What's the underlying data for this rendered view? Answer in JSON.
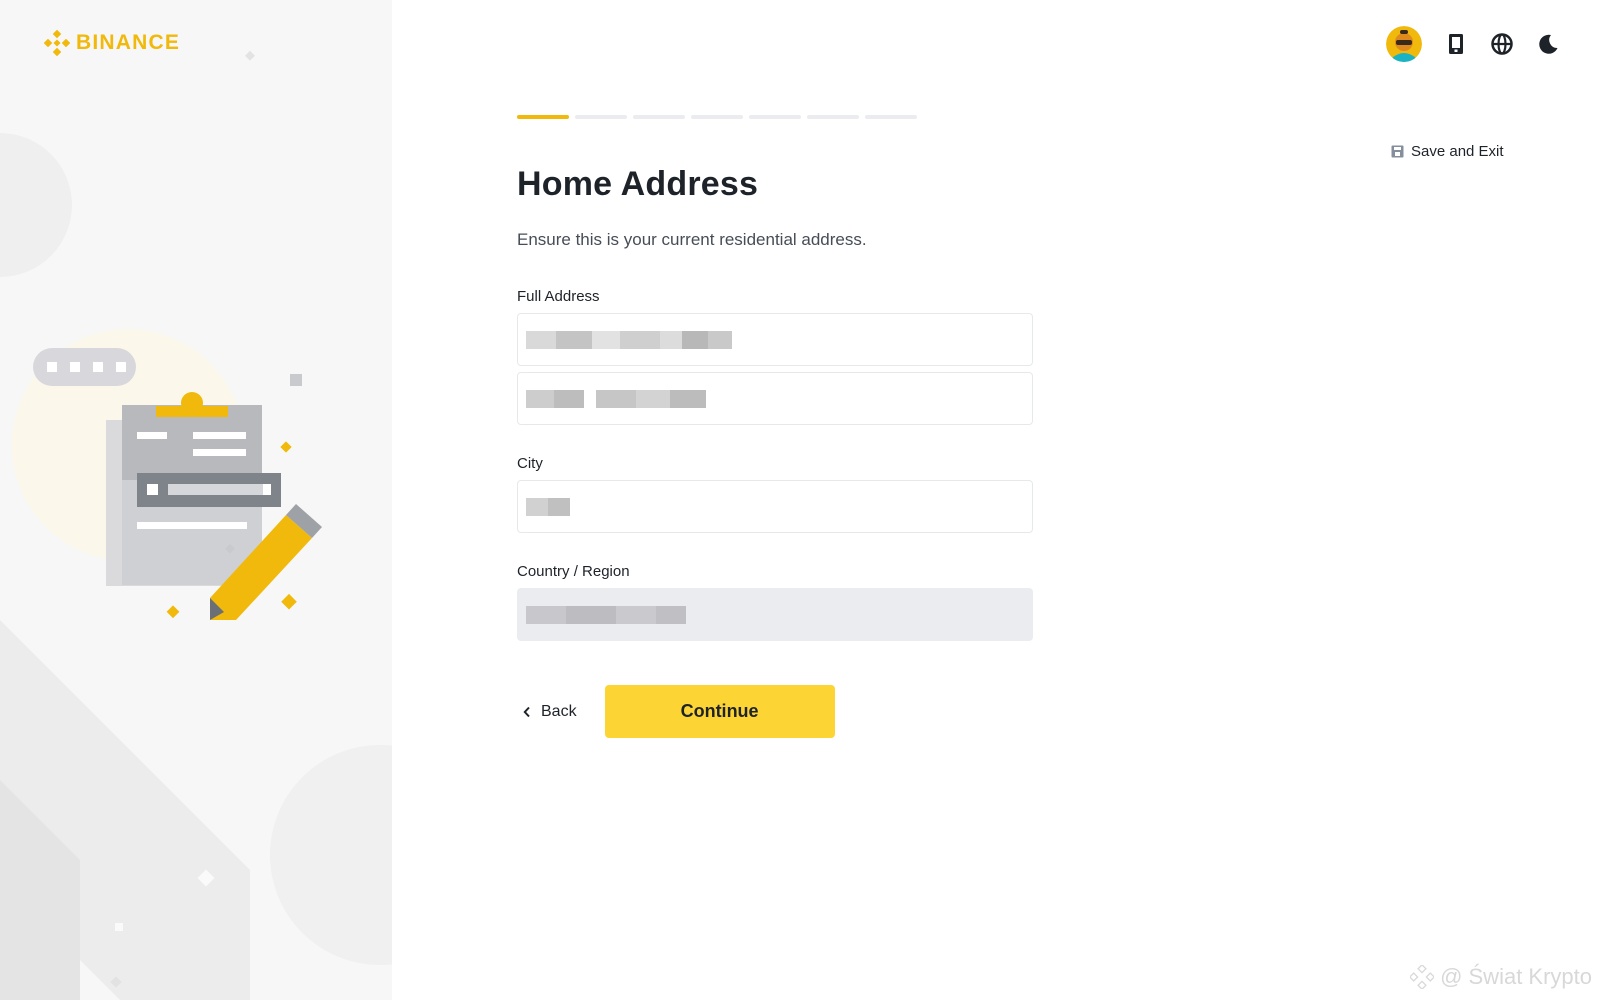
{
  "brand": {
    "name": "BINANCE",
    "color": "#f0b90b"
  },
  "header": {
    "icons": [
      "avatar",
      "download-icon",
      "globe-icon",
      "moon-icon"
    ],
    "save_exit_label": "Save and Exit"
  },
  "progress": {
    "total_steps": 7,
    "current_step": 1
  },
  "form": {
    "title": "Home Address",
    "subtitle": "Ensure this is your current residential address.",
    "full_address_label": "Full Address",
    "city_label": "City",
    "country_label": "Country / Region"
  },
  "actions": {
    "back_label": "Back",
    "continue_label": "Continue"
  },
  "watermark": "@ Świat Krypto",
  "colors": {
    "accent": "#fcd535",
    "text": "#1e2329",
    "muted": "#474d57",
    "border": "#e6e8ea"
  }
}
